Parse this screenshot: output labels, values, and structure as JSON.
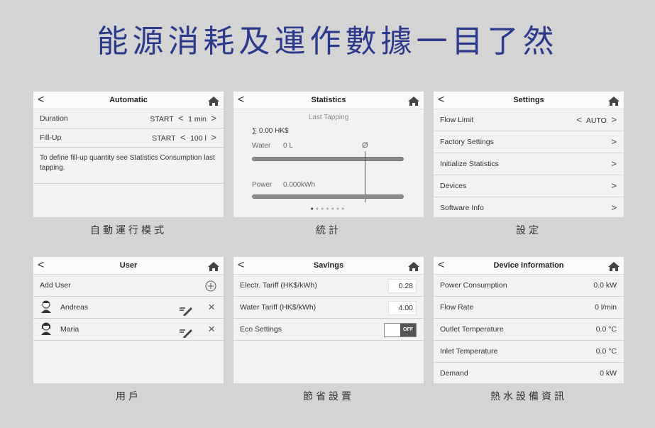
{
  "headline": "能源消耗及運作數據一目了然",
  "panels": {
    "automatic": {
      "title": "Automatic",
      "rows": [
        {
          "label": "Duration",
          "start": "START",
          "value": "1 min"
        },
        {
          "label": "Fill-Up",
          "start": "START",
          "value": "100 l"
        }
      ],
      "note": "To define fill-up quantity see Statistics Consumption last tapping.",
      "caption": "自動運行模式"
    },
    "statistics": {
      "title": "Statistics",
      "subtitle": "Last Tapping",
      "sum": "∑ 0.00 HK$",
      "water_label": "Water",
      "water_value": "0 L",
      "avg_symbol": "Ø",
      "power_label": "Power",
      "power_value": "0.000kWh",
      "page_count": 7,
      "active_page": 1,
      "caption": "統計"
    },
    "settings": {
      "title": "Settings",
      "rows": [
        {
          "label": "Flow Limit",
          "value": "AUTO"
        },
        {
          "label": "Factory Settings",
          "value": ""
        },
        {
          "label": "Initialize Statistics",
          "value": ""
        },
        {
          "label": "Devices",
          "value": ""
        },
        {
          "label": "Software Info",
          "value": ""
        }
      ],
      "caption": "設定"
    },
    "user": {
      "title": "User",
      "add_label": "Add User",
      "users": [
        {
          "name": "Andreas"
        },
        {
          "name": "Maria"
        }
      ],
      "caption": "用戶"
    },
    "savings": {
      "title": "Savings",
      "rows": [
        {
          "label": "Electr. Tariff (HK$/kWh)",
          "value": "0.28"
        },
        {
          "label": "Water Tariff (HK$/kWh)",
          "value": "4.00"
        }
      ],
      "eco_label": "Eco Settings",
      "eco_state": "OFF",
      "caption": "節省設置"
    },
    "device_info": {
      "title": "Device Information",
      "rows": [
        {
          "label": "Power Consumption",
          "value": "0.0 kW"
        },
        {
          "label": "Flow Rate",
          "value": "0 l/min"
        },
        {
          "label": "Outlet Temperature",
          "value": "0.0 °C"
        },
        {
          "label": "Inlet Temperature",
          "value": "0.0 °C"
        },
        {
          "label": "Demand",
          "value": "0 kW"
        }
      ],
      "caption": "熱水設備資訊"
    }
  },
  "icons": {
    "back": "chevron-left-icon",
    "home": "home-icon",
    "edit": "pencil-icon",
    "delete": "close-icon",
    "add": "plus-circle-icon"
  },
  "colors": {
    "headline": "#2b3a8a",
    "background": "#d4d4d4",
    "panel": "#f2f2f2"
  }
}
